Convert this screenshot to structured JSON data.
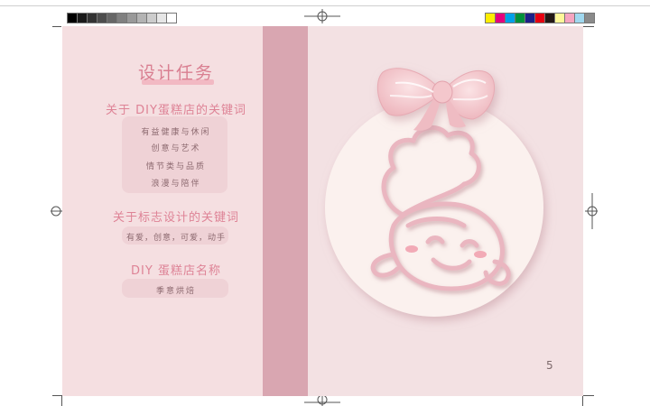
{
  "title": "设计任务",
  "sections": [
    {
      "heading": "关于 DIY蛋糕店的关键词",
      "items": [
        "有益健康与休闲",
        "创意与艺术",
        "情节类与品质",
        "浪漫与陪伴"
      ]
    },
    {
      "heading": "关于标志设计的关键词",
      "items": [
        "有爱，创意，可爱，动手"
      ]
    },
    {
      "heading": "DIY 蛋糕店名称",
      "items": [
        "季意烘焙"
      ]
    }
  ],
  "page_number": "5",
  "colors": {
    "left_page": "#f5dfe1",
    "spine": "#d9a6b1",
    "right_page": "#f3e1e3",
    "heading": "#de8396",
    "circle": "#fbf1ee",
    "bow": "#f3c9cd"
  },
  "icons": [
    "pink-bow-icon",
    "chef-baby-icon"
  ]
}
